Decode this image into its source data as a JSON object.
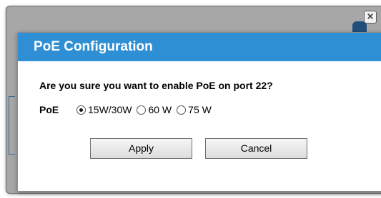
{
  "dialog": {
    "title": "PoE Configuration",
    "question": "Are you sure you want to enable PoE on port 22?",
    "poe_label": "PoE",
    "options": [
      {
        "label": "15W/30W",
        "selected": true
      },
      {
        "label": "60 W",
        "selected": false
      },
      {
        "label": "75 W",
        "selected": false
      }
    ],
    "apply_label": "Apply",
    "cancel_label": "Cancel"
  },
  "window": {
    "close_glyph": "×"
  },
  "colors": {
    "titlebar": "#2f8fd4",
    "outer_window": "#a7a7a7"
  },
  "icons": {
    "close": "close-icon",
    "radio": "radio-icon"
  }
}
